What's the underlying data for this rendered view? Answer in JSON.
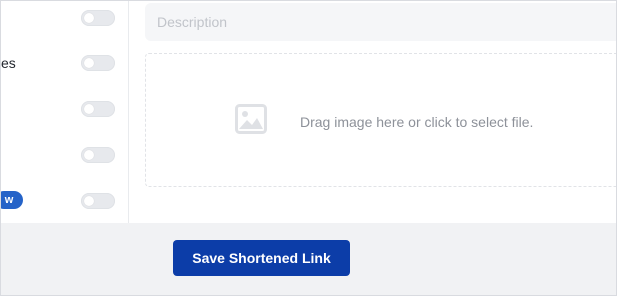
{
  "left_settings": {
    "rows": [
      {
        "label": "",
        "badge": "",
        "toggle_on": false
      },
      {
        "label": "es",
        "badge": "",
        "toggle_on": false
      },
      {
        "label": "",
        "badge": "",
        "toggle_on": false
      },
      {
        "label": "",
        "badge": "",
        "toggle_on": false
      },
      {
        "label": "",
        "badge": "w",
        "toggle_on": false
      }
    ]
  },
  "form": {
    "description": {
      "value": "",
      "placeholder": "Description"
    },
    "image_dropzone": {
      "icon": "image-icon",
      "text": "Drag image here or click to select file."
    }
  },
  "footer": {
    "save_label": "Save Shortened Link"
  },
  "colors": {
    "primary": "#0c3da8",
    "badge": "#2563c8",
    "toggle_off": "#e7e9ed",
    "footer_bg": "#f1f2f4"
  }
}
